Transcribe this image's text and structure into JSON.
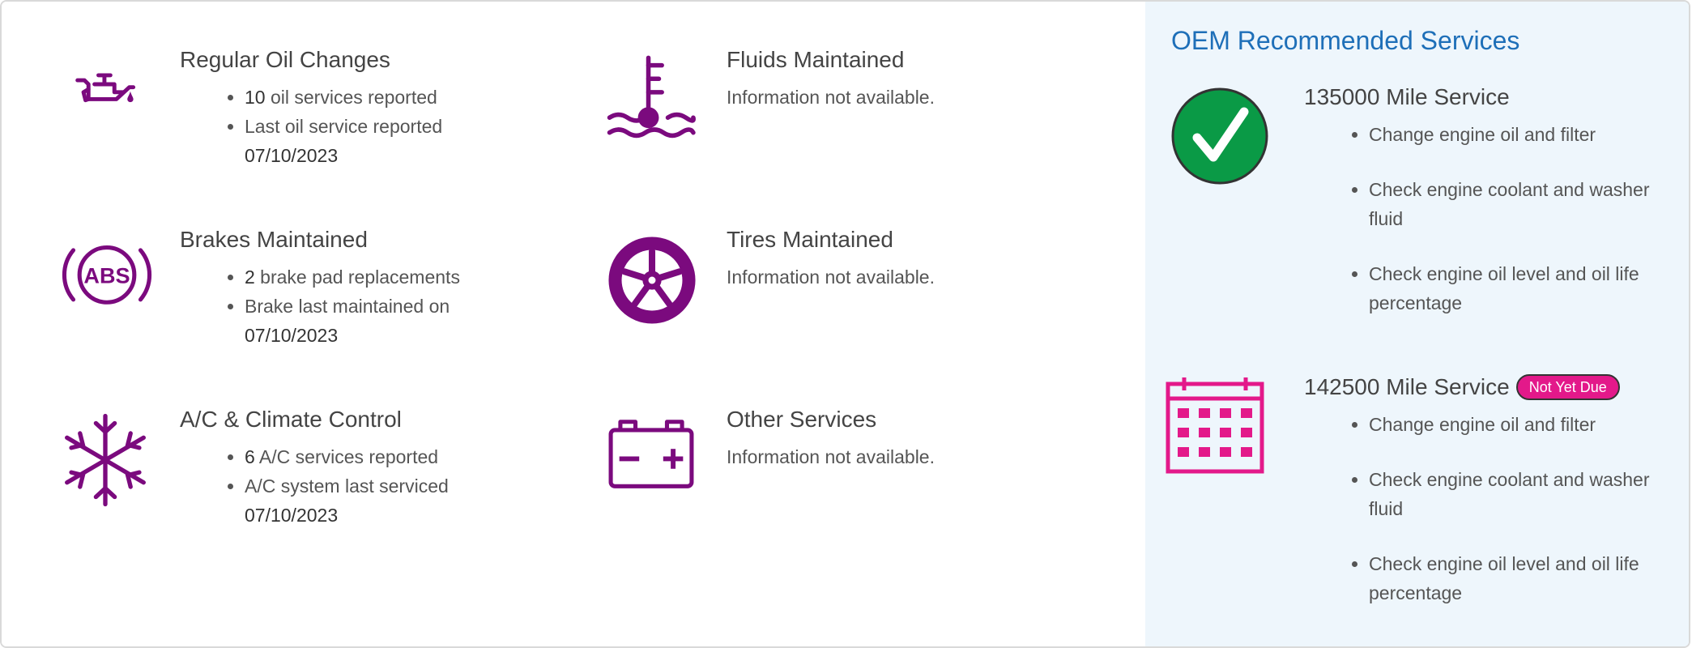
{
  "services": {
    "oil": {
      "title": "Regular Oil Changes",
      "count": "10",
      "count_text": " oil services reported",
      "last_label": "Last oil service reported",
      "last_date": "07/10/2023",
      "icon": "oil-can-icon"
    },
    "fluids": {
      "title": "Fluids Maintained",
      "status": "Information not available.",
      "icon": "coolant-temperature-icon"
    },
    "brakes": {
      "title": "Brakes Maintained",
      "count": "2",
      "count_text": " brake pad replacements",
      "last_label": "Brake last maintained on",
      "last_date": "07/10/2023",
      "icon_text": "ABS",
      "icon": "abs-brake-icon"
    },
    "tires": {
      "title": "Tires Maintained",
      "status": "Information not available.",
      "icon": "wheel-icon"
    },
    "ac": {
      "title": "A/C & Climate Control",
      "count": "6",
      "count_text": " A/C services reported",
      "last_label": "A/C system last serviced",
      "last_date": "07/10/2023",
      "icon": "snowflake-icon"
    },
    "other": {
      "title": "Other Services",
      "status": "Information not available.",
      "icon": "battery-icon"
    }
  },
  "oem": {
    "title": "OEM Recommended Services",
    "services": [
      {
        "name": "135000 Mile Service",
        "icon": "check-circle-icon",
        "items": [
          "Change engine oil and filter",
          "Check engine coolant and washer fluid",
          "Check engine oil level and oil life percentage"
        ]
      },
      {
        "name": "142500 Mile Service",
        "badge": "Not Yet Due",
        "icon": "calendar-icon",
        "items": [
          "Change engine oil and filter",
          "Check engine coolant and washer fluid",
          "Check engine oil level and oil life percentage"
        ]
      }
    ]
  },
  "colors": {
    "purple": "#7b0a7e",
    "green": "#0a9a46",
    "magenta": "#e3198a",
    "heading_blue": "#1e6fb8",
    "panel_bg": "#eef6fc"
  }
}
